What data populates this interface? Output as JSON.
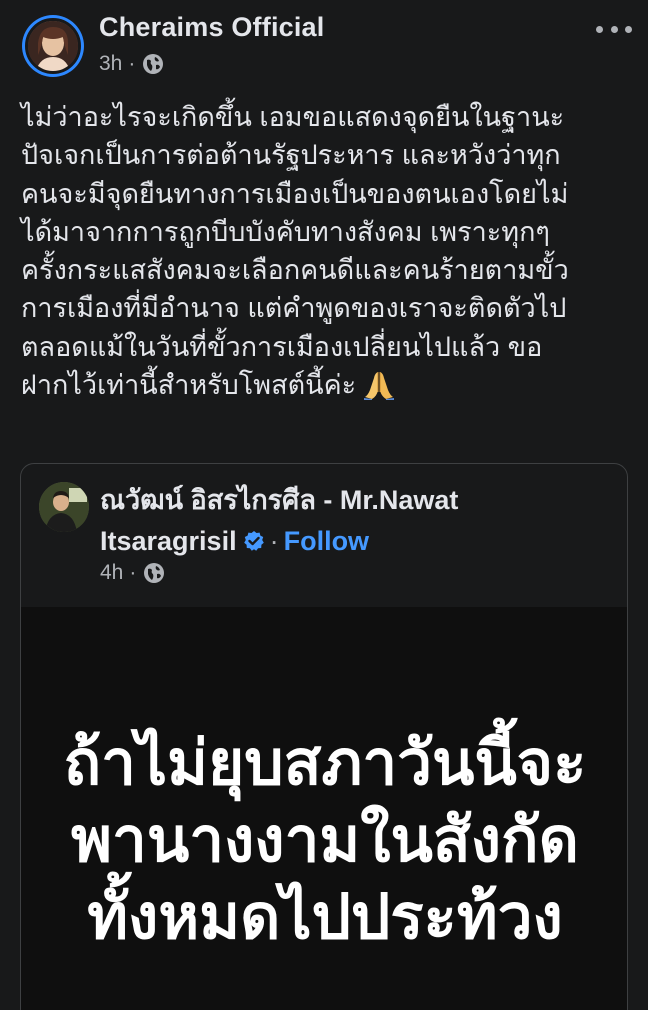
{
  "post": {
    "author": "Cheraims Official",
    "time": "3h",
    "dot": "·",
    "privacy_icon": "globe-icon",
    "more_icon": "more-options-icon",
    "text_lines": [
      "ไม่ว่าอะไรจะเกิดขึ้น เอมขอแสดงจุดยืนในฐานะ",
      "ปัจเจกเป็นการต่อต้านรัฐประหาร และหวังว่าทุก",
      "คนจะมีจุดยืนทางการเมืองเป็นของตนเองโดยไม่",
      "ได้มาจากการถูกบีบบังคับทางสังคม เพราะทุกๆ",
      "ครั้งกระแสสังคมจะเลือกคนดีและคนร้ายตามขั้ว",
      "การเมืองที่มีอำนาจ แต่คำพูดของเราจะติดตัวไป",
      "ตลอดแม้ในวันที่ขั้วการเมืองเปลี่ยนไปแล้ว ขอ",
      "ฝากไว้เท่านี้สำหรับโพสต์นี้ค่ะ"
    ],
    "emoji": "pray-emoji"
  },
  "shared": {
    "name_line1": "ณวัฒน์ อิสรไกรศีล - Mr.Nawat",
    "name_line2": "Itsaragrisil",
    "dot": "·",
    "follow_label": "Follow",
    "time": "4h",
    "verified_color": "#4599ff",
    "image_text_lines": [
      "ถ้าไม่ยุบสภาวันนี้จะ",
      "พานางงามในสังกัด",
      "ทั้งหมดไปประท้วง"
    ]
  },
  "colors": {
    "background": "#18191a",
    "text": "#e4e6eb",
    "secondary": "#b0b3b8",
    "accent": "#4599ff",
    "avatar_ring": "#2d88ff"
  }
}
